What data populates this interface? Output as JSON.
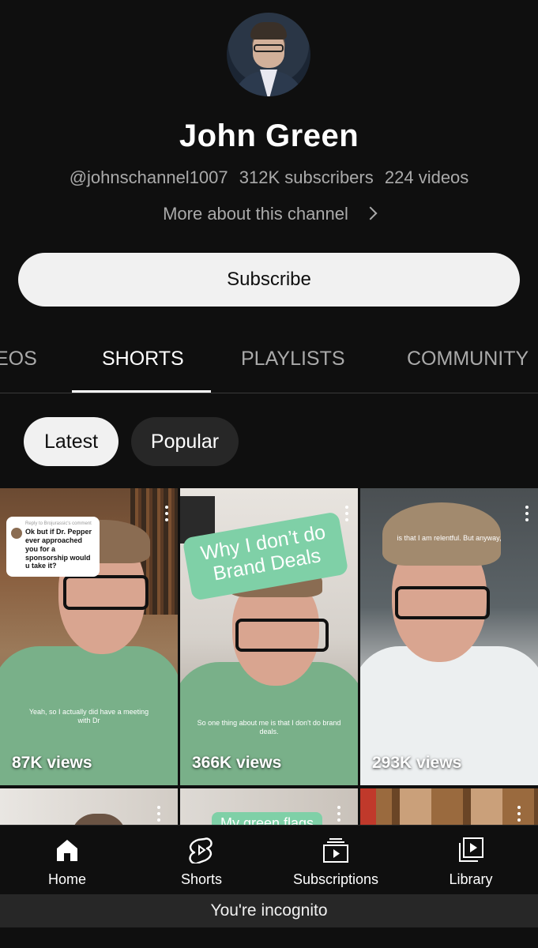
{
  "channel": {
    "name": "John Green",
    "handle": "@johnschannel1007",
    "subscribers": "312K subscribers",
    "videos": "224 videos",
    "more_about": "More about this channel",
    "subscribe_label": "Subscribe"
  },
  "tabs": [
    {
      "label": "VIDEOS",
      "visible_text": "EOS"
    },
    {
      "label": "SHORTS",
      "active": true
    },
    {
      "label": "PLAYLISTS"
    },
    {
      "label": "COMMUNITY"
    }
  ],
  "chips": [
    {
      "label": "Latest",
      "selected": true
    },
    {
      "label": "Popular",
      "selected": false
    }
  ],
  "shorts": [
    {
      "views": "87K views",
      "overlay_reply": "Reply to Brojurassic's comment",
      "overlay_question": "Ok but if Dr. Pepper ever approached you for a sponsorship would u take it?",
      "caption": "Yeah, so I actually did have a meeting with Dr"
    },
    {
      "views": "366K views",
      "title_card": "Why I don’t do Brand Deals",
      "caption": "So one thing about me is that I don't do brand deals."
    },
    {
      "views": "293K views",
      "caption": "is that I am relentful. But anyway,"
    }
  ],
  "partial_row": [
    {
      "caption": ""
    },
    {
      "caption": "My green flags"
    },
    {
      "caption": ""
    }
  ],
  "nav": {
    "items": [
      {
        "label": "Home",
        "icon": "home-icon"
      },
      {
        "label": "Shorts",
        "icon": "shorts-icon"
      },
      {
        "label": "Subscriptions",
        "icon": "subscriptions-icon"
      },
      {
        "label": "Library",
        "icon": "library-icon"
      }
    ]
  },
  "incognito_label": "You're incognito",
  "colors": {
    "background": "#0f0f0f",
    "chip_selected": "#f1f1f1",
    "chip_unselected": "#272727",
    "secondary_text": "#aaaaaa",
    "brand_card": "#7fd0a7"
  }
}
